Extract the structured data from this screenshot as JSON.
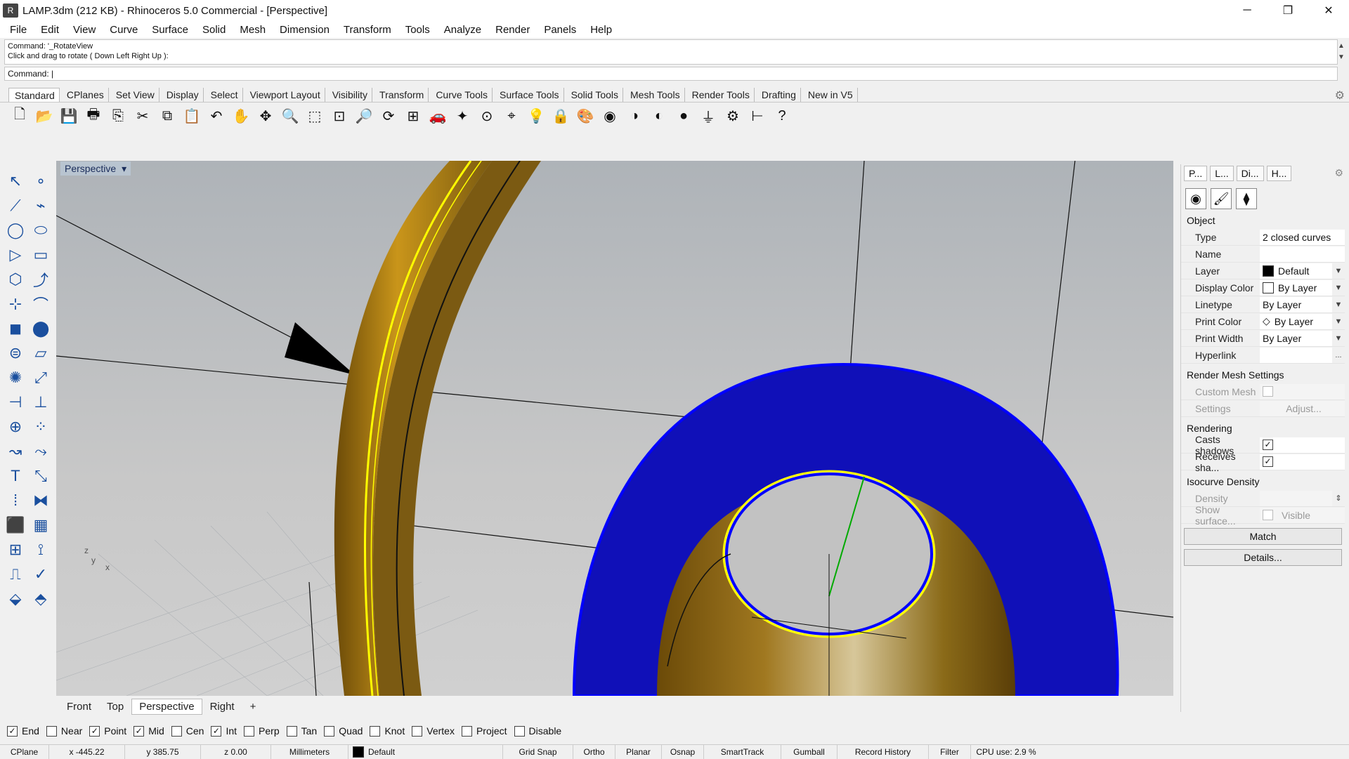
{
  "window": {
    "title": "LAMP.3dm (212 KB) - Rhinoceros 5.0 Commercial - [Perspective]",
    "icon": "rhino-icon",
    "minimize": "─",
    "restore": "❐",
    "close": "✕"
  },
  "menu": [
    "File",
    "Edit",
    "View",
    "Curve",
    "Surface",
    "Solid",
    "Mesh",
    "Dimension",
    "Transform",
    "Tools",
    "Analyze",
    "Render",
    "Panels",
    "Help"
  ],
  "command": {
    "history_line1": "Command: '_RotateView",
    "history_line2": "Click and drag to rotate ( Down  Left  Right  Up ):",
    "prompt": "Command:"
  },
  "toolbar_tabs": [
    "Standard",
    "CPlanes",
    "Set View",
    "Display",
    "Select",
    "Viewport Layout",
    "Visibility",
    "Transform",
    "Curve Tools",
    "Surface Tools",
    "Solid Tools",
    "Mesh Tools",
    "Render Tools",
    "Drafting",
    "New in V5"
  ],
  "toolbar_icons": [
    "new-icon",
    "open-icon",
    "save-icon",
    "print-icon",
    "import-icon",
    "cut-icon",
    "copy-icon",
    "paste-icon",
    "undo-icon",
    "pan-icon",
    "move-icon",
    "zoom-icon",
    "zoom-window-icon",
    "zoom-extents-icon",
    "zoom-selected-icon",
    "rotate-view-icon",
    "viewport-layout-icon",
    "car-icon",
    "light-icon",
    "cplane-icon",
    "snap-icon",
    "bulb-icon",
    "lock-icon",
    "render-icon",
    "color-wheel-icon",
    "material-icon",
    "shaded-icon",
    "sphere-icon",
    "filter-icon",
    "gear-tools-icon",
    "dimension-icon",
    "help-icon"
  ],
  "toolbar_glyphs": [
    "🗋",
    "📂",
    "💾",
    "🖶",
    "⎘",
    "✂",
    "⧉",
    "📋",
    "↶",
    "✋",
    "✥",
    "🔍",
    "⬚",
    "⊡",
    "🔎",
    "⟳",
    "⊞",
    "🚗",
    "✦",
    "⊙",
    "⌖",
    "💡",
    "🔒",
    "🎨",
    "◉",
    "◑",
    "◐",
    "●",
    "⏚",
    "⚙",
    "⊢",
    "?"
  ],
  "left_tools": [
    "select-icon",
    "point-icon",
    "polyline-icon",
    "curve-edit-icon",
    "circle-icon",
    "ellipse-icon",
    "polygon-icon",
    "rectangle-icon",
    "hexagon-icon",
    "fillet-icon",
    "surface-pts-icon",
    "surface-edit-icon",
    "box-icon",
    "boolean-icon",
    "cylinder-icon",
    "plane-icon",
    "explode-icon",
    "extend-icon",
    "trim-icon",
    "split-icon",
    "group-icon",
    "blocks-icon",
    "curve-tools-icon",
    "rebuild-icon",
    "text-icon",
    "scale-icon",
    "array-icon",
    "deform-icon",
    "solid-icon",
    "hatch-icon",
    "grid-icon",
    "dimension-icon",
    "cage-icon",
    "check-icon",
    "box-edit-icon",
    "paint-icon"
  ],
  "left_glyphs": [
    "↖",
    "∘",
    "⟋",
    "⌁",
    "◯",
    "⬭",
    "▷",
    "▭",
    "⬡",
    "⤴",
    "⊹",
    "⌒",
    "◼",
    "⬤",
    "⊜",
    "▱",
    "✺",
    "⤢",
    "⊣",
    "⊥",
    "⊕",
    "⁘",
    "↝",
    "⤳",
    "T",
    "⤡",
    "⁞",
    "⧓",
    "⬛",
    "▦",
    "⊞",
    "⟟",
    "⎍",
    "✓",
    "⬙",
    "⬘"
  ],
  "viewport": {
    "title": "Perspective",
    "menu_arrow": "▾",
    "axis_z": "z",
    "axis_y": "y",
    "axis_x": "x"
  },
  "view_tabs": [
    "Front",
    "Top",
    "Perspective",
    "Right",
    "+"
  ],
  "osnaps": [
    {
      "label": "End",
      "checked": true
    },
    {
      "label": "Near",
      "checked": false
    },
    {
      "label": "Point",
      "checked": true
    },
    {
      "label": "Mid",
      "checked": true
    },
    {
      "label": "Cen",
      "checked": false
    },
    {
      "label": "Int",
      "checked": true
    },
    {
      "label": "Perp",
      "checked": false
    },
    {
      "label": "Tan",
      "checked": false
    },
    {
      "label": "Quad",
      "checked": false
    },
    {
      "label": "Knot",
      "checked": false
    },
    {
      "label": "Vertex",
      "checked": false
    },
    {
      "label": "Project",
      "checked": false
    },
    {
      "label": "Disable",
      "checked": false
    }
  ],
  "status": {
    "cplane": "CPlane",
    "x": "x -445.22",
    "y": "y 385.75",
    "z": "z 0.00",
    "units": "Millimeters",
    "layer": "Default",
    "grid_snap": "Grid Snap",
    "ortho": "Ortho",
    "planar": "Planar",
    "osnap": "Osnap",
    "smarttrack": "SmartTrack",
    "gumball": "Gumball",
    "record_history": "Record History",
    "filter": "Filter",
    "cpu": "CPU use: 2.9 %"
  },
  "panel": {
    "tabs": [
      "P...",
      "L...",
      "Di...",
      "H..."
    ],
    "object_section": "Object",
    "rows": [
      {
        "key": "Type",
        "value": "2 closed curves"
      },
      {
        "key": "Name",
        "value": ""
      },
      {
        "key": "Layer",
        "value": "Default"
      },
      {
        "key": "Display Color",
        "value": "By Layer"
      },
      {
        "key": "Linetype",
        "value": "By Layer"
      },
      {
        "key": "Print Color",
        "value": "By Layer"
      },
      {
        "key": "Print Width",
        "value": "By Layer"
      },
      {
        "key": "Hyperlink",
        "value": "..."
      }
    ],
    "render_mesh_section": "Render Mesh Settings",
    "custom_mesh": "Custom Mesh",
    "settings": "Settings",
    "adjust": "Adjust...",
    "rendering_section": "Rendering",
    "casts_shadows": "Casts shadows",
    "receives_shadows": "Receives sha...",
    "isocurve_section": "Isocurve Density",
    "density": "Density",
    "show_surface": "Show surface...",
    "visible": "Visible",
    "match": "Match",
    "details": "Details..."
  },
  "colors": {
    "surface_gold": "#b8860b",
    "surface_blue": "#0000cc",
    "highlight_yellow": "#ffff00",
    "viewport_title_bg": "#b8c4d0"
  }
}
